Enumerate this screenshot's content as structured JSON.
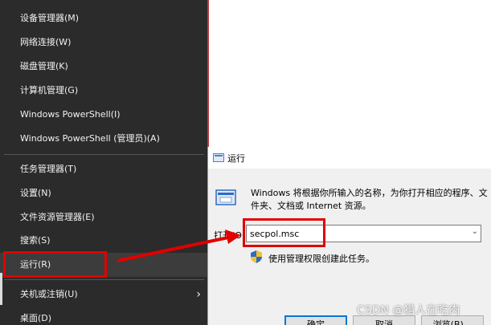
{
  "winx_menu": {
    "items": [
      {
        "label": "设备管理器(M)"
      },
      {
        "label": "网络连接(W)"
      },
      {
        "label": "磁盘管理(K)"
      },
      {
        "label": "计算机管理(G)"
      },
      {
        "label": "Windows PowerShell(I)"
      },
      {
        "label": "Windows PowerShell (管理员)(A)"
      },
      {
        "label": "任务管理器(T)"
      },
      {
        "label": "设置(N)"
      },
      {
        "label": "文件资源管理器(E)"
      },
      {
        "label": "搜索(S)"
      },
      {
        "label": "运行(R)",
        "highlighted": true
      },
      {
        "label": "关机或注销(U)",
        "has_submenu": true
      },
      {
        "label": "桌面(D)"
      }
    ]
  },
  "run_dialog": {
    "title": "运行",
    "description": "Windows 将根据你所输入的名称，为你打开相应的程序、文件夹、文档或 Internet 资源。",
    "open_label": "打开(O):",
    "open_value": "secpol.msc",
    "admin_note": "使用管理权限创建此任务。",
    "ok_label": "确定",
    "cancel_label": "取消",
    "browse_label": "浏览(B)..."
  },
  "watermark": "CSDN @猎人在吃肉",
  "colors": {
    "menu_bg": "#2b2b2b",
    "annotation_red": "#e00000",
    "focus_blue": "#0078d7"
  }
}
